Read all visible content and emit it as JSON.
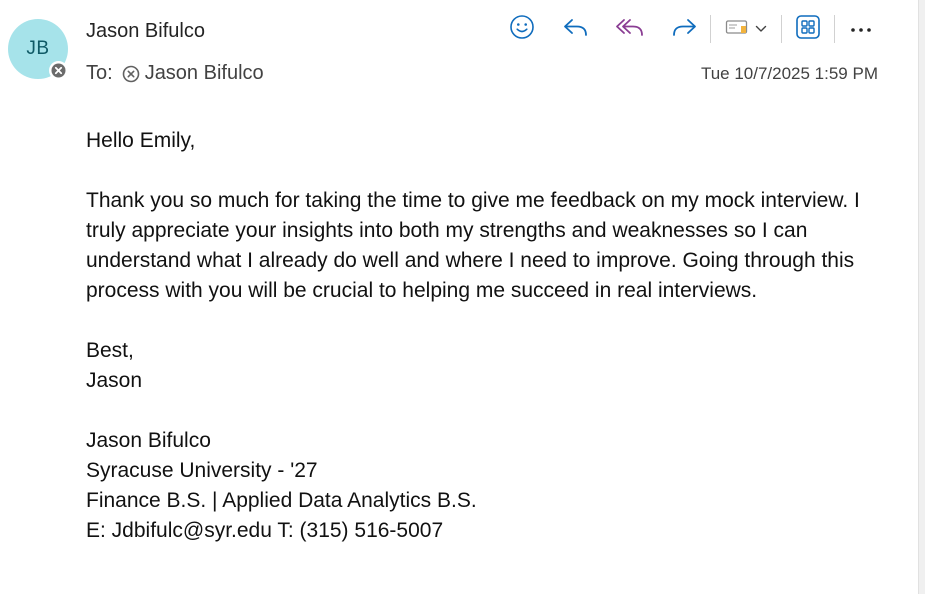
{
  "sender": {
    "initials": "JB",
    "name": "Jason Bifulco"
  },
  "recipients": {
    "label": "To:",
    "name": "Jason Bifulco"
  },
  "date": "Tue 10/7/2025 1:59 PM",
  "toolbar": {
    "icons": [
      "emoji-react-icon",
      "reply-icon",
      "reply-all-icon",
      "forward-icon",
      "tag-icon",
      "chevron-down-icon",
      "apps-icon",
      "more-icon"
    ],
    "accent_color": "#0f6cbd",
    "reply_all_color": "#8a3d93"
  },
  "message": {
    "greeting": "Hello Emily,",
    "paragraph": "Thank you so much for taking the time to give me feedback on my mock interview. I truly appreciate your insights into both my strengths and weaknesses so I can understand what I already do well and where I need to improve. Going through this process with you will be crucial to helping me succeed in real interviews.",
    "closing": "Best,",
    "closing_name": "Jason"
  },
  "signature": {
    "name": "Jason Bifulco",
    "school": "Syracuse University - '27",
    "degrees": "Finance B.S. | Applied Data Analytics B.S.",
    "contact": "E: Jdbifulc@syr.edu T: (315) 516-5007"
  }
}
